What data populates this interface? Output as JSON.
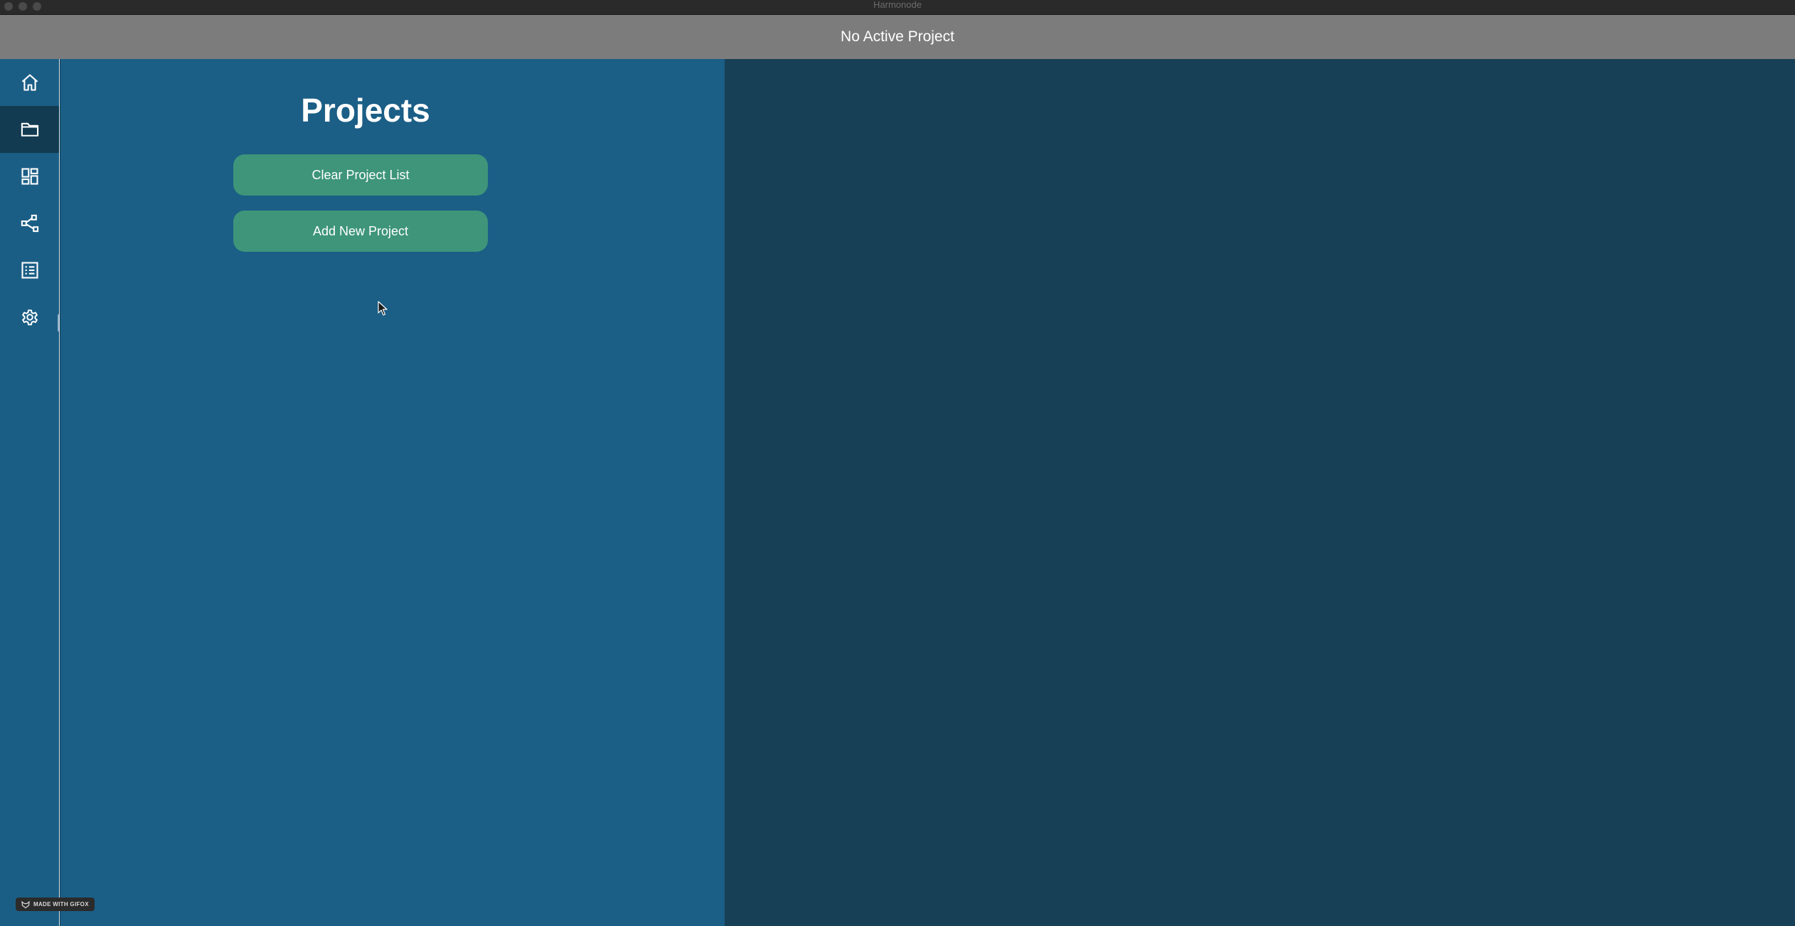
{
  "window": {
    "title": "Harmonode"
  },
  "header": {
    "title": "No Active Project"
  },
  "sidebar": {
    "items": [
      {
        "icon": "home-icon",
        "active": false
      },
      {
        "icon": "folder-icon",
        "active": true
      },
      {
        "icon": "dashboard-icon",
        "active": false
      },
      {
        "icon": "node-graph-icon",
        "active": false
      },
      {
        "icon": "list-icon",
        "active": false
      },
      {
        "icon": "gear-icon",
        "active": false
      }
    ]
  },
  "projects_panel": {
    "title": "Projects",
    "clear_button_label": "Clear Project List",
    "add_button_label": "Add New Project"
  },
  "badge": {
    "label": "MADE WITH GIFOX"
  },
  "colors": {
    "sidebar_bg": "#1b5e85",
    "panel_bg": "#1b5e86",
    "content_bg": "#173f55",
    "header_bg": "#7c7c7c",
    "button_bg": "#3e9579",
    "active_nav_bg": "#123b52"
  }
}
